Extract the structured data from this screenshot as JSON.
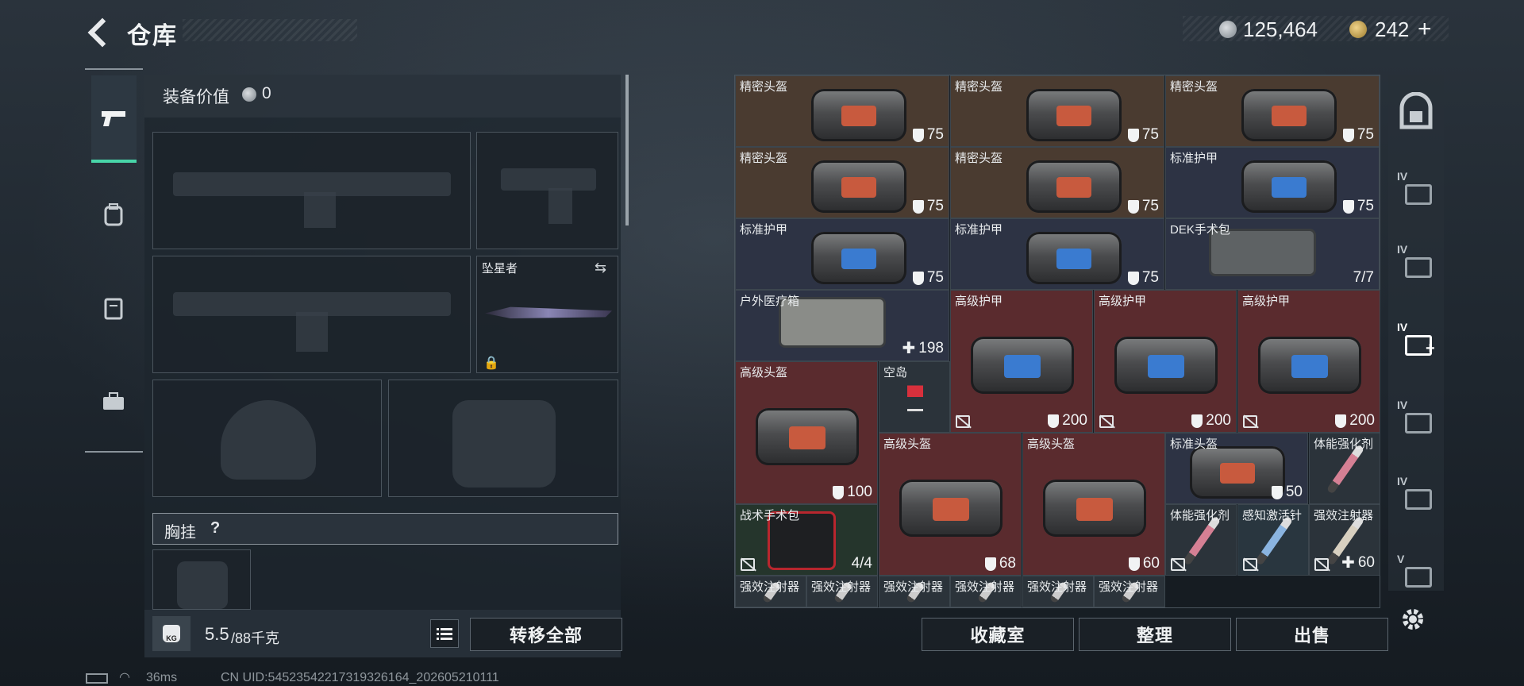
{
  "header": {
    "title": "仓库",
    "currency_silver": "125,464",
    "currency_gold": "242",
    "gold_plus": "+"
  },
  "left_panel": {
    "equip_value_label": "装备价值",
    "equip_value": "0",
    "melee_name": "坠星者",
    "chest_rig_label": "胸挂",
    "chest_rig_help": "?",
    "weight_value": "5.5",
    "weight_max": "/88千克",
    "kg_label": "KG",
    "transfer_all": "转移全部"
  },
  "grid": {
    "items": [
      {
        "name": "精密头盔",
        "value": "75",
        "kind": "shield"
      },
      {
        "name": "精密头盔",
        "value": "75",
        "kind": "shield"
      },
      {
        "name": "精密头盔",
        "value": "75",
        "kind": "shield"
      },
      {
        "name": "精密头盔",
        "value": "75",
        "kind": "shield"
      },
      {
        "name": "精密头盔",
        "value": "75",
        "kind": "shield"
      },
      {
        "name": "标准护甲",
        "value": "75",
        "kind": "shield"
      },
      {
        "name": "标准护甲",
        "value": "75",
        "kind": "shield"
      },
      {
        "name": "标准护甲",
        "value": "75",
        "kind": "shield"
      },
      {
        "name": "DEK手术包",
        "value": "7/7",
        "kind": "count"
      },
      {
        "name": "户外医疗箱",
        "value": "198",
        "kind": "heal"
      },
      {
        "name": "高级护甲",
        "value": "200",
        "kind": "shield"
      },
      {
        "name": "高级护甲",
        "value": "200",
        "kind": "shield"
      },
      {
        "name": "高级护甲",
        "value": "200",
        "kind": "shield"
      },
      {
        "name": "高级头盔",
        "value": "100",
        "kind": "shield"
      },
      {
        "name": "空岛",
        "value": "",
        "kind": "none"
      },
      {
        "name": "高级头盔",
        "value": "68",
        "kind": "shield"
      },
      {
        "name": "高级头盔",
        "value": "60",
        "kind": "shield"
      },
      {
        "name": "标准头盔",
        "value": "50",
        "kind": "shield"
      },
      {
        "name": "体能强化剂",
        "value": "",
        "kind": "none"
      },
      {
        "name": "战术手术包",
        "value": "4/4",
        "kind": "count"
      },
      {
        "name": "体能强化剂",
        "value": "",
        "kind": "none"
      },
      {
        "name": "感知激活针",
        "value": "",
        "kind": "none"
      },
      {
        "name": "强效注射器",
        "value": "60",
        "kind": "heal"
      },
      {
        "name": "强效注射器",
        "value": "",
        "kind": "none"
      },
      {
        "name": "强效注射器",
        "value": "",
        "kind": "none"
      },
      {
        "name": "强效注射器",
        "value": "",
        "kind": "none"
      },
      {
        "name": "强效注射器",
        "value": "",
        "kind": "none"
      },
      {
        "name": "强效注射器",
        "value": "",
        "kind": "none"
      },
      {
        "name": "强效注射器",
        "value": "",
        "kind": "none"
      }
    ]
  },
  "actions": {
    "collection": "收藏室",
    "sort": "整理",
    "sell": "出售"
  },
  "right_nav": {
    "tier_iv": "IV",
    "tier_v": "V"
  },
  "status": {
    "ping": "36ms",
    "uid": "CN UID:545235422173193261​64_202605210111"
  },
  "colors": {
    "accent": "#48d5a8",
    "rare_red": "#5a2b2e",
    "rare_blue": "#2d3344",
    "rare_brown": "#4a3b30"
  }
}
